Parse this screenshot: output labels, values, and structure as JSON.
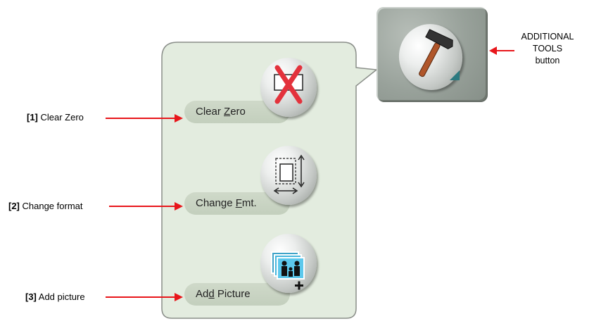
{
  "additional_tools": {
    "label_lines": [
      "ADDITIONAL",
      "TOOLS",
      "button"
    ],
    "icon": "hammer-icon"
  },
  "actions": [
    {
      "pre": "Clear ",
      "mnemonic": "Z",
      "post": "ero",
      "icon": "clear-zero-icon"
    },
    {
      "pre": "Change ",
      "mnemonic": "F",
      "post": "mt.",
      "icon": "change-format-icon"
    },
    {
      "pre": "Ad",
      "mnemonic": "d",
      "post": " Picture",
      "icon": "add-picture-icon"
    }
  ],
  "annotations": [
    {
      "num": "[1]",
      "text": " Clear Zero"
    },
    {
      "num": "[2]",
      "text": " Change format"
    },
    {
      "num": "[3]",
      "text": " Add picture"
    }
  ],
  "colors": {
    "arrow": "#e8161b",
    "panel": "#e3ecdf",
    "panel_border": "#8a8e89",
    "tool_bg": "#9aa39c"
  }
}
